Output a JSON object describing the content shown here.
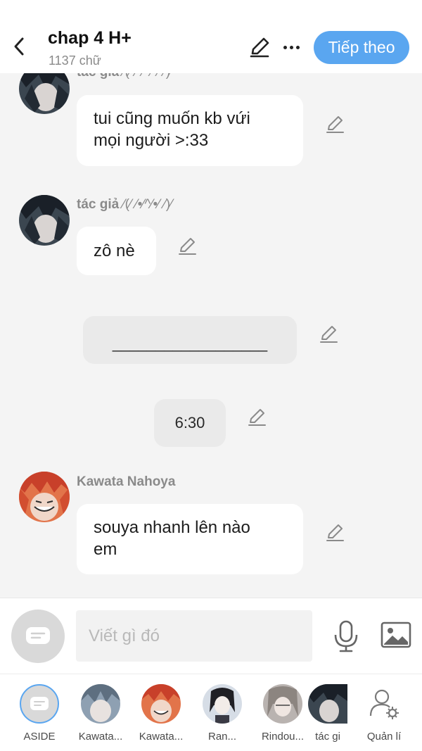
{
  "header": {
    "title": "chap 4 H+",
    "word_count": "1137 chữ",
    "next_label": "Tiếp theo"
  },
  "messages": [
    {
      "sender": "tác giả",
      "tag": "⁄(⁄ ⁄•⁄^⁄•⁄ ⁄)⁄",
      "text_line1": "tui cũng muốn kb vứi",
      "text_line2": "mọi người >:33"
    },
    {
      "sender": "tác giả",
      "tag": "⁄(⁄ ⁄•⁄^⁄•⁄ ⁄)⁄",
      "text": "zô nè"
    },
    {
      "narration": "__________________"
    },
    {
      "narration": "6:30"
    },
    {
      "sender": "Kawata Nahoya",
      "text_line1": "souya nhanh lên nào",
      "text_line2": "em"
    }
  ],
  "input": {
    "placeholder": "Viết gì đó"
  },
  "characters": [
    {
      "name": "ASIDE"
    },
    {
      "name": "Kawata..."
    },
    {
      "name": "Kawata..."
    },
    {
      "name": "Ran..."
    },
    {
      "name": "Rindou..."
    },
    {
      "name": "tác gi"
    },
    {
      "name": "Quản lí"
    }
  ],
  "colors": {
    "accent": "#5aa6f0",
    "background": "#f4f4f4",
    "bubble": "#ffffff",
    "narration_bubble": "#eaeaea",
    "meta_text": "#8a8a8a"
  },
  "icons": [
    "back-icon",
    "pencil-icon",
    "more-icon",
    "chat-bubble-icon",
    "microphone-icon",
    "image-icon",
    "user-gear-icon"
  ]
}
